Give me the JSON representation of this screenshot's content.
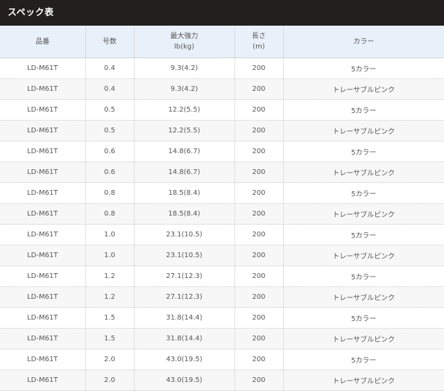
{
  "title": "スペック表",
  "headers": [
    {
      "lines": [
        "品番"
      ]
    },
    {
      "lines": [
        "号数"
      ]
    },
    {
      "lines": [
        "最大強力",
        "lb(kg)"
      ]
    },
    {
      "lines": [
        "長さ",
        "(m)"
      ]
    },
    {
      "lines": [
        "カラー"
      ]
    }
  ],
  "rows": [
    [
      "LD-M61T",
      "0.4",
      "9.3(4.2)",
      "200",
      "5カラー"
    ],
    [
      "LD-M61T",
      "0.4",
      "9.3(4.2)",
      "200",
      "トレーサブルピンク"
    ],
    [
      "LD-M61T",
      "0.5",
      "12.2(5.5)",
      "200",
      "5カラー"
    ],
    [
      "LD-M61T",
      "0.5",
      "12.2(5.5)",
      "200",
      "トレーサブルピンク"
    ],
    [
      "LD-M61T",
      "0.6",
      "14.8(6.7)",
      "200",
      "5カラー"
    ],
    [
      "LD-M61T",
      "0.6",
      "14.8(6.7)",
      "200",
      "トレーサブルピンク"
    ],
    [
      "LD-M61T",
      "0.8",
      "18.5(8.4)",
      "200",
      "5カラー"
    ],
    [
      "LD-M61T",
      "0.8",
      "18.5(8.4)",
      "200",
      "トレーサブルピンク"
    ],
    [
      "LD-M61T",
      "1.0",
      "23.1(10.5)",
      "200",
      "5カラー"
    ],
    [
      "LD-M61T",
      "1.0",
      "23.1(10.5)",
      "200",
      "トレーサブルピンク"
    ],
    [
      "LD-M61T",
      "1.2",
      "27.1(12.3)",
      "200",
      "5カラー"
    ],
    [
      "LD-M61T",
      "1.2",
      "27.1(12.3)",
      "200",
      "トレーサブルピンク"
    ],
    [
      "LD-M61T",
      "1.5",
      "31.8(14.4)",
      "200",
      "5カラー"
    ],
    [
      "LD-M61T",
      "1.5",
      "31.8(14.4)",
      "200",
      "トレーサブルピンク"
    ],
    [
      "LD-M61T",
      "2.0",
      "43.0(19.5)",
      "200",
      "5カラー"
    ],
    [
      "LD-M61T",
      "2.0",
      "43.0(19.5)",
      "200",
      "トレーサブルピンク"
    ]
  ],
  "colors": {
    "title_bar": "#231f1f",
    "header_bg": "#e8f1f9",
    "stripe_bg": "#f7f7f7"
  }
}
